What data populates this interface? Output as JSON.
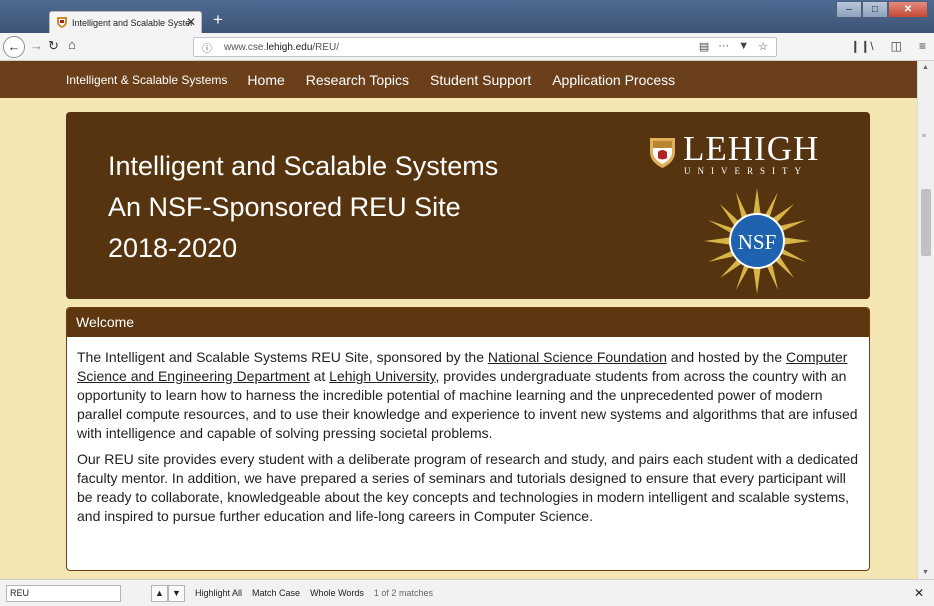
{
  "browser": {
    "tab_title": "Intelligent and Scalable System",
    "tab_close": "✕",
    "new_tab": "+",
    "window_min": "–",
    "window_max": "□",
    "window_close": "✕",
    "url_scheme_icon": "ⓘ",
    "url_prefix": "www.cse.",
    "url_host": "lehigh.edu",
    "url_path": "/REU/",
    "icons": [
      "back-icon",
      "forward-icon",
      "reload-icon",
      "home-icon",
      "reader-view-icon",
      "page-actions-icon",
      "pocket-icon",
      "bookmark-star-icon",
      "library-icon",
      "sidebar-icon",
      "menu-icon"
    ]
  },
  "site_nav": {
    "brand": "Intelligent & Scalable Systems",
    "links": [
      "Home",
      "Research Topics",
      "Student Support",
      "Application Process"
    ]
  },
  "hero": {
    "line1": "Intelligent and Scalable Systems",
    "line2": "An NSF-Sponsored REU Site",
    "line3": "2018-2020",
    "lehigh_word": "LEHIGH",
    "lehigh_sub": "UNIVERSITY",
    "nsf_text": "NSF"
  },
  "welcome": {
    "heading": "Welcome",
    "p1_a": "The Intelligent and Scalable Systems REU Site, sponsored by the ",
    "p1_link1": "National Science Foundation",
    "p1_b": " and hosted by the ",
    "p1_link2": "Computer Science and Engineering Department",
    "p1_c": " at ",
    "p1_link3": "Lehigh University",
    "p1_d": ", provides undergraduate students from across the country with an opportunity to learn how to harness the incredible potential of machine learning and the unprecedented power of modern parallel compute resources, and to use their knowledge and experience to invent new systems and algorithms that are infused with intelligence and capable of solving pressing societal problems.",
    "p2": "Our REU site provides every student with a deliberate program of research and study, and pairs each student with a dedicated faculty mentor. In addition, we have prepared a series of seminars and tutorials designed to ensure that every participant will be ready to collaborate, knowledgeable about the key concepts and technologies in modern intelligent and scalable systems, and inspired to pursue further education and life-long careers in Computer Science."
  },
  "findbar": {
    "value": "REU",
    "highlight_all": "Highlight All",
    "match_case": "Match Case",
    "whole_words": "Whole Words",
    "status": "1 of 2 matches",
    "close": "✕"
  },
  "colors": {
    "page_bg": "#f3e6b3",
    "nav_bg": "#6b3f1a",
    "hero_bg": "#55340f",
    "card_head_bg": "#5e3711"
  }
}
